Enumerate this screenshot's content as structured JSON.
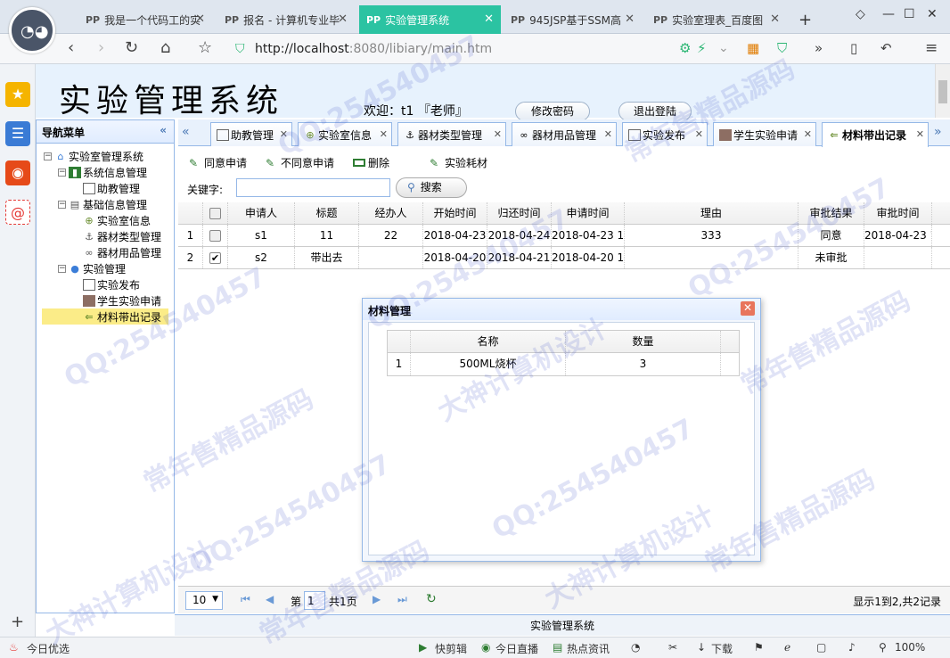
{
  "browser": {
    "tabs": [
      {
        "label": "我是一个代码工的实",
        "active": false
      },
      {
        "label": "报名 - 计算机专业毕",
        "active": false
      },
      {
        "label": "实验管理系统",
        "active": true
      },
      {
        "label": "945JSP基于SSM高",
        "active": false
      },
      {
        "label": "实验室理表_百度图",
        "active": false
      }
    ],
    "new_tab": "+",
    "url_host": "http://localhost",
    "url_rest": ":8080/libiary/main.htm"
  },
  "app": {
    "title": "实验管理系统",
    "welcome": "欢迎：t1 『老师』",
    "change_password": "修改密码",
    "logout": "退出登陆",
    "footer": "实验管理系统"
  },
  "sidebar": {
    "header": "导航菜单",
    "collapse": "«",
    "root": "实验室管理系统",
    "groups": [
      {
        "label": "系统信息管理",
        "items": [
          "助教管理"
        ]
      },
      {
        "label": "基础信息管理",
        "items": [
          "实验室信息",
          "器材类型管理",
          "器材用品管理"
        ]
      },
      {
        "label": "实验管理",
        "items": [
          "实验发布",
          "学生实验申请",
          "材料带出记录"
        ]
      }
    ]
  },
  "maintabs": [
    "助教管理",
    "实验室信息",
    "器材类型管理",
    "器材用品管理",
    "实验发布",
    "学生实验申请",
    "材料带出记录"
  ],
  "toolbar": {
    "agree": "同意申请",
    "disagree": "不同意申请",
    "delete": "删除",
    "consumable": "实验耗材"
  },
  "search": {
    "label": "关键字:",
    "value": "",
    "button": "搜索"
  },
  "grid": {
    "columns": [
      "申请人",
      "标题",
      "经办人",
      "开始时间",
      "归还时间",
      "申请时间",
      "理由",
      "审批结果",
      "审批时间"
    ],
    "rows": [
      {
        "no": "1",
        "checked": false,
        "cells": [
          "s1",
          "11",
          "22",
          "2018-04-23",
          "2018-04-24",
          "2018-04-23 1",
          "333",
          "同意",
          "2018-04-23 1"
        ]
      },
      {
        "no": "2",
        "checked": true,
        "cells": [
          "s2",
          "带出去",
          "",
          "2018-04-20",
          "2018-04-21",
          "2018-04-20 1",
          "",
          "未审批",
          ""
        ]
      }
    ]
  },
  "pager": {
    "page_size": "10",
    "page_prefix": "第",
    "page_value": "1",
    "page_total": "共1页",
    "summary": "显示1到2,共2记录"
  },
  "dialog": {
    "title": "材料管理",
    "columns": [
      "名称",
      "数量"
    ],
    "rows": [
      {
        "no": "1",
        "name": "500ML烧杯",
        "qty": "3"
      }
    ]
  },
  "statusbar": {
    "left": "今日优选",
    "items": [
      "快剪辑",
      "今日直播",
      "热点资讯",
      "下载"
    ],
    "zoom": "100%"
  },
  "watermarks": [
    "QQ:254540457",
    "常年售精品源码",
    "大神计算机设计"
  ],
  "colors": {
    "accent_tab": "#2bc3a2",
    "panel_border": "#95b8e7",
    "selected_tree": "#fbec88",
    "header_bg": "#e7f2fd"
  }
}
